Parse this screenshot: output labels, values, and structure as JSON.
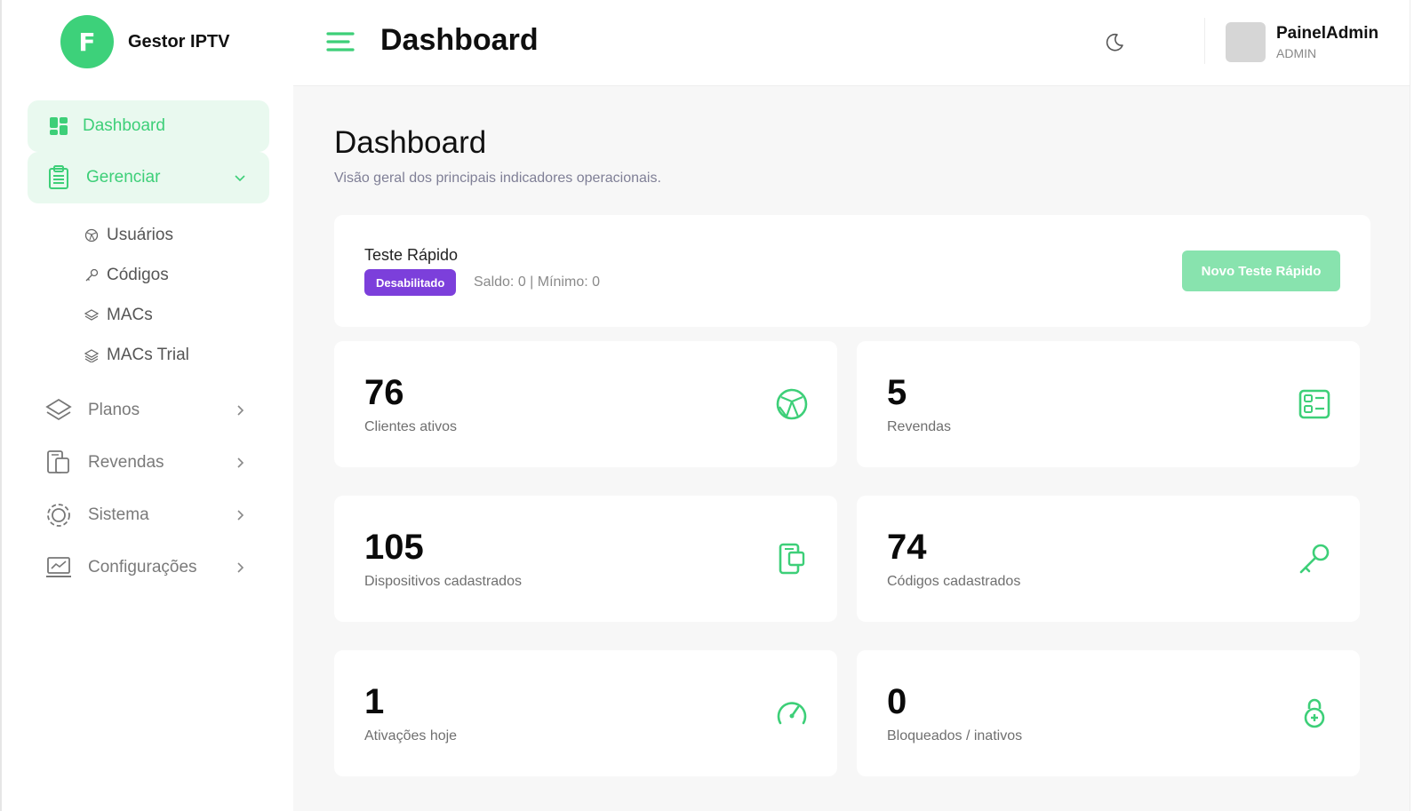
{
  "brand": {
    "logo_letter": "F",
    "name": "Gestor IPTV"
  },
  "sidebar": {
    "items": [
      {
        "label": "Dashboard",
        "icon": "dashboard-icon",
        "active": true
      },
      {
        "label": "Gerenciar",
        "icon": "clipboard-icon",
        "expanded": true
      },
      {
        "label": "Planos",
        "icon": "layers-icon"
      },
      {
        "label": "Revendas",
        "icon": "devices-icon"
      },
      {
        "label": "Sistema",
        "icon": "gear-icon"
      },
      {
        "label": "Configurações",
        "icon": "monitor-chart-icon"
      }
    ],
    "sub_items": [
      {
        "label": "Usuários",
        "icon": "globe-icon"
      },
      {
        "label": "Códigos",
        "icon": "key-icon"
      },
      {
        "label": "MACs",
        "icon": "layers-icon"
      },
      {
        "label": "MACs Trial",
        "icon": "layers-icon"
      }
    ]
  },
  "header": {
    "title": "Dashboard",
    "user": {
      "name": "PainelAdmin",
      "role": "ADMIN"
    }
  },
  "main": {
    "title": "Dashboard",
    "subtitle": "Visão geral dos principais indicadores operacionais.",
    "quick_test": {
      "title": "Teste Rápido",
      "status_badge": "Desabilitado",
      "saldo_text": "Saldo: 0 | Mínimo: 0",
      "button_label": "Novo Teste Rápido"
    },
    "stats": [
      {
        "value": "76",
        "label": "Clientes ativos",
        "icon": "globe-icon"
      },
      {
        "value": "5",
        "label": "Revendas",
        "icon": "server-list-icon"
      },
      {
        "value": "105",
        "label": "Dispositivos cadastrados",
        "icon": "devices-icon"
      },
      {
        "value": "74",
        "label": "Códigos cadastrados",
        "icon": "key-icon"
      },
      {
        "value": "1",
        "label": "Ativações hoje",
        "icon": "speedometer-icon"
      },
      {
        "value": "0",
        "label": "Bloqueados / inativos",
        "icon": "lock-icon"
      }
    ]
  },
  "colors": {
    "accent": "#3dcf78",
    "accent_light": "#e9f9ef",
    "badge": "#7c3fdb",
    "button": "#88e3ae"
  }
}
